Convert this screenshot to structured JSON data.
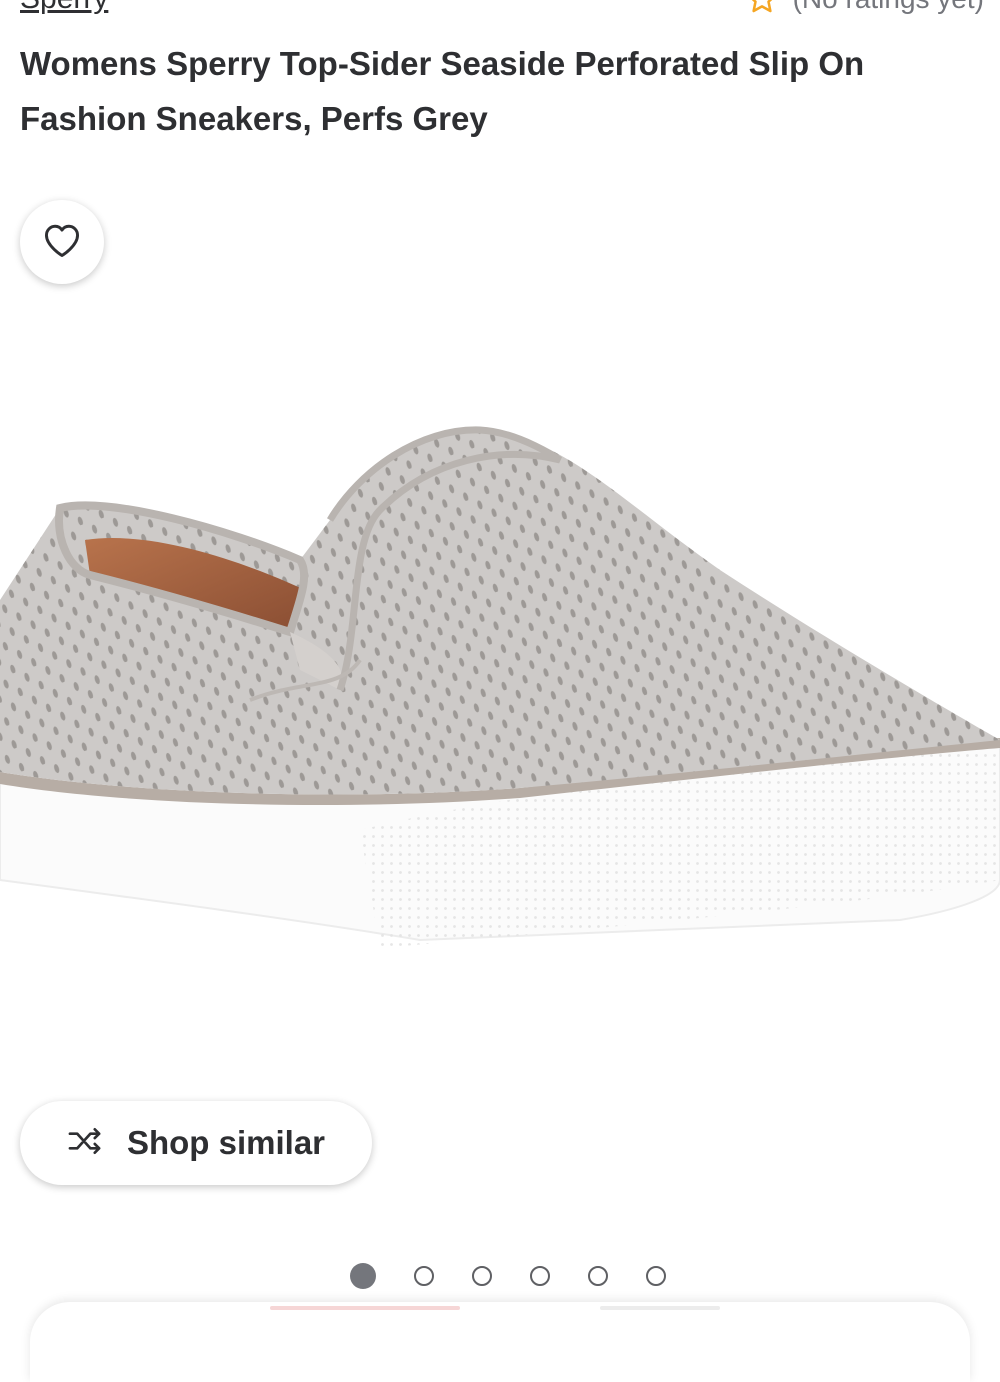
{
  "product": {
    "brand": "Sperry",
    "rating_text": "(No ratings yet)",
    "title": "Womens Sperry Top-Sider Seaside Perforated Slip On Fashion Sneakers, Perfs Grey"
  },
  "actions": {
    "shop_similar_label": "Shop similar"
  },
  "carousel": {
    "image_count": 6,
    "active_index": 0
  },
  "colors": {
    "text": "#2e2f32",
    "muted": "#74767c",
    "star": "#f5a623",
    "shoe_grey": "#c9c6c4",
    "sole_white": "#fbfbfb"
  },
  "icons": {
    "rating": "star-outline-icon",
    "favorite": "heart-outline-icon",
    "shop_similar": "shuffle-icon"
  }
}
